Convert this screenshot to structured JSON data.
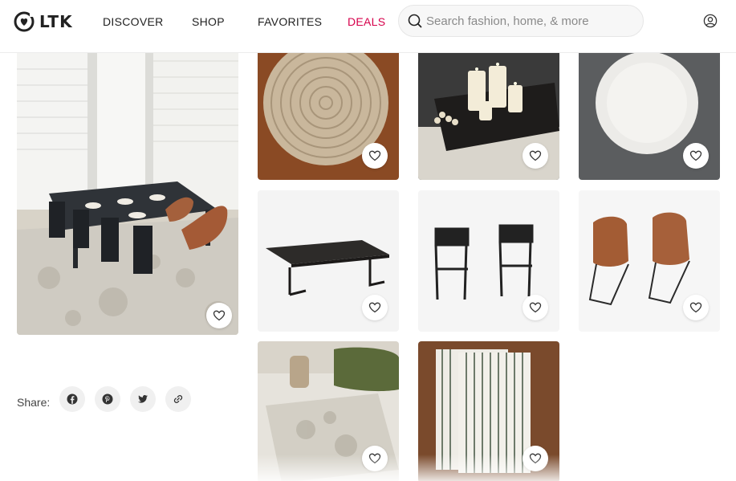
{
  "brand": {
    "logo_text": "LTK"
  },
  "nav": {
    "discover": "DISCOVER",
    "shop": "SHOP",
    "favorites": "FAVORITES",
    "deals": "DEALS"
  },
  "search": {
    "placeholder": "Search fashion, home, & more",
    "value": ""
  },
  "share": {
    "label": "Share:"
  },
  "colors": {
    "deals_accent": "#d6004b",
    "text": "#222222"
  },
  "icons": [
    "ltk-logo-icon",
    "search-icon",
    "account-icon",
    "heart-icon",
    "facebook-icon",
    "pinterest-icon",
    "twitter-icon",
    "link-icon"
  ],
  "products": [
    {
      "kind": "rattan charger placemat"
    },
    {
      "kind": "black tray with pillar candles"
    },
    {
      "kind": "white dinner plate"
    },
    {
      "kind": "black dining table"
    },
    {
      "kind": "black wood dining chairs"
    },
    {
      "kind": "leather slope dining chairs"
    },
    {
      "kind": "distressed area rug"
    },
    {
      "kind": "striped cloth napkins"
    }
  ]
}
